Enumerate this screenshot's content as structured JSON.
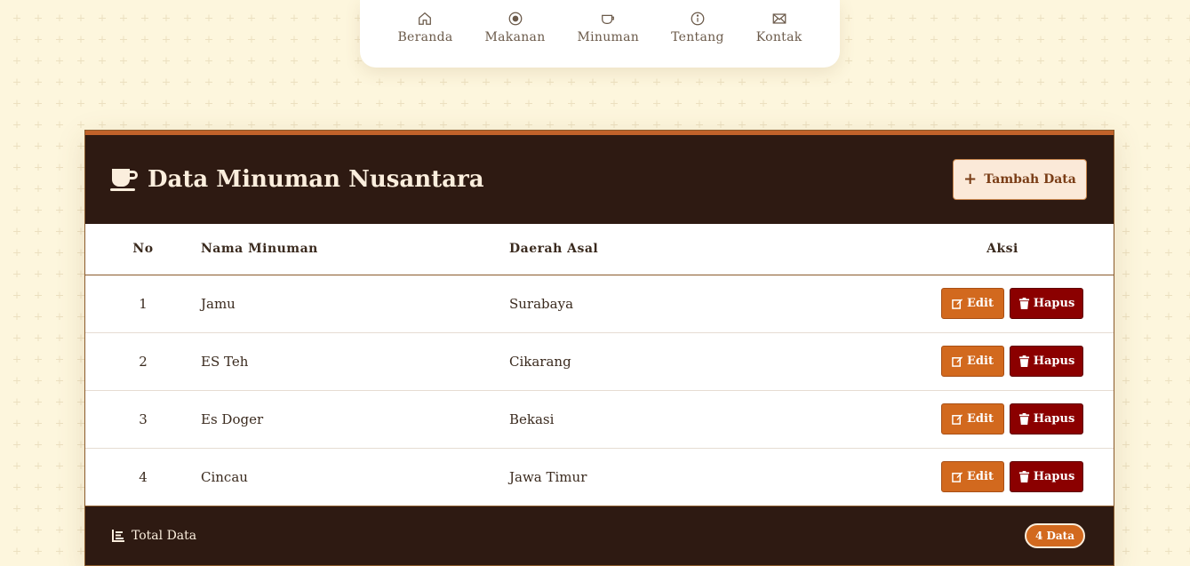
{
  "nav": {
    "items": [
      {
        "label": "Beranda",
        "icon": "home-icon"
      },
      {
        "label": "Makanan",
        "icon": "food-icon"
      },
      {
        "label": "Minuman",
        "icon": "cup-icon"
      },
      {
        "label": "Tentang",
        "icon": "info-icon"
      },
      {
        "label": "Kontak",
        "icon": "mail-icon"
      }
    ]
  },
  "card": {
    "title": "Data Minuman Nusantara",
    "add_button": "Tambah Data",
    "columns": {
      "no": "No",
      "name": "Nama Minuman",
      "region": "Daerah Asal",
      "action": "Aksi"
    },
    "rows": [
      {
        "no": "1",
        "name": "Jamu",
        "region": "Surabaya"
      },
      {
        "no": "2",
        "name": "ES Teh",
        "region": "Cikarang"
      },
      {
        "no": "3",
        "name": "Es Doger",
        "region": "Bekasi"
      },
      {
        "no": "4",
        "name": "Cincau",
        "region": "Jawa Timur"
      }
    ],
    "edit_label": "Edit",
    "delete_label": "Hapus",
    "footer": {
      "label": "Total Data",
      "badge": "4 Data"
    }
  },
  "colors": {
    "background": "#fdf6dd",
    "header_dark": "#2e1a12",
    "accent_orange": "#d2691e",
    "delete_red": "#8b0000"
  }
}
